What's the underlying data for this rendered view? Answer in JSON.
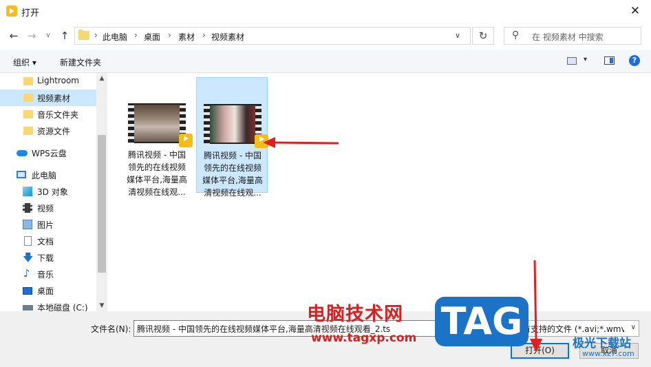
{
  "window": {
    "title": "打开",
    "close_glyph": "✕"
  },
  "nav": {
    "back": "←",
    "forward": "→",
    "recent": "∨",
    "up": "↑",
    "refresh": "↻"
  },
  "address": {
    "crumbs": [
      "此电脑",
      "桌面",
      "素材",
      "视频素材"
    ],
    "separator": "›",
    "dropdown": "∨"
  },
  "search": {
    "placeholder": "在 视频素材 中搜索",
    "icon": "search-icon"
  },
  "toolbar": {
    "organize": "组织 ▾",
    "new_folder": "新建文件夹",
    "view_dropdown": "▾",
    "help": "?"
  },
  "sidebar": {
    "items": [
      {
        "label": "Lightroom",
        "icon": "folder-icon"
      },
      {
        "label": "视频素材",
        "icon": "folder-icon",
        "selected": true
      },
      {
        "label": "音乐文件夹",
        "icon": "folder-icon"
      },
      {
        "label": "资源文件",
        "icon": "folder-icon"
      },
      {
        "label": "WPS云盘",
        "icon": "cloud-icon"
      },
      {
        "label": "此电脑",
        "icon": "computer-icon"
      },
      {
        "label": "3D 对象",
        "icon": "3d-objects-icon"
      },
      {
        "label": "视频",
        "icon": "video-icon"
      },
      {
        "label": "图片",
        "icon": "pictures-icon"
      },
      {
        "label": "文档",
        "icon": "documents-icon"
      },
      {
        "label": "下载",
        "icon": "download-icon"
      },
      {
        "label": "音乐",
        "icon": "music-icon"
      },
      {
        "label": "桌面",
        "icon": "desktop-icon"
      },
      {
        "label": "本地磁盘 (C:)",
        "icon": "disk-icon"
      }
    ]
  },
  "scrollbar": {
    "up": "▲",
    "down": "▼"
  },
  "files": [
    {
      "name_lines": [
        "腾讯视频 - 中国",
        "领先的在线视频",
        "媒体平台,海量高",
        "清视频在线观..."
      ],
      "badge": "Player",
      "selected": false
    },
    {
      "name_lines": [
        "腾讯视频 - 中国",
        "领先的在线视频",
        "媒体平台,海量高",
        "清视频在线观..."
      ],
      "badge": "Player",
      "selected": true
    }
  ],
  "footer": {
    "filename_label": "文件名(N):",
    "filename_value": "腾讯视频 - 中国领先的在线视频媒体平台,海量高清视频在线观看_2.ts",
    "filetype_value": "所有支持的文件 (*.avi;*.wmv;*.",
    "filetype_dropdown": "∨",
    "open_label": "打开(O)",
    "cancel_label": "取消"
  },
  "watermarks": {
    "site_name": "电脑技术网",
    "site_url": "www.tagxp.com",
    "tag": "TAG",
    "right_name": "极光下载站",
    "right_url": "www.xz7.com"
  },
  "colors": {
    "accent": "#0078d7",
    "selection": "#cce8ff",
    "annotation": "#e02020",
    "badge": "#f5bd19"
  }
}
